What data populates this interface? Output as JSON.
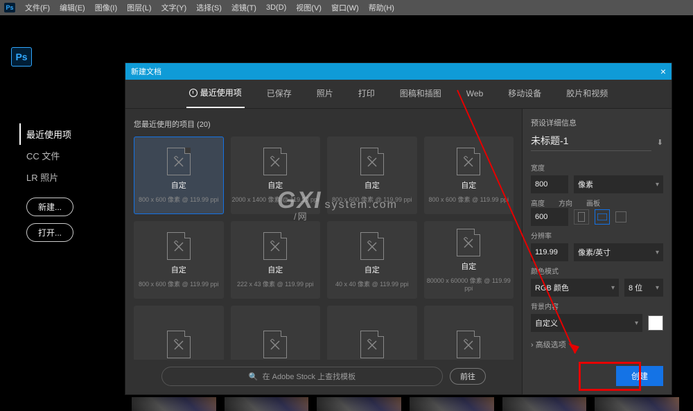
{
  "menubar": {
    "logo": "Ps",
    "items": [
      "文件(F)",
      "编辑(E)",
      "图像(I)",
      "图层(L)",
      "文字(Y)",
      "选择(S)",
      "滤镜(T)",
      "3D(D)",
      "视图(V)",
      "窗口(W)",
      "帮助(H)"
    ]
  },
  "workspace": {
    "logo": "Ps",
    "left_items": [
      "最近使用项",
      "CC 文件",
      "LR 照片"
    ],
    "active_left": 0,
    "new_btn": "新建...",
    "open_btn": "打开..."
  },
  "dialog": {
    "title": "新建文档",
    "tabs": [
      "最近使用项",
      "已保存",
      "照片",
      "打印",
      "图稿和插图",
      "Web",
      "移动设备",
      "胶片和视频"
    ],
    "active_tab": 0,
    "recent_label": "您最近使用的项目  (20)",
    "presets": [
      {
        "name": "自定",
        "dim": "800 x 600 像素 @ 119.99 ppi",
        "selected": true
      },
      {
        "name": "自定",
        "dim": "2000 x 1400 像素 @ 119.99 ppi"
      },
      {
        "name": "自定",
        "dim": "800 x 600 像素 @ 119.99 ppi"
      },
      {
        "name": "自定",
        "dim": "800 x 600 像素 @ 119.99 ppi"
      },
      {
        "name": "自定",
        "dim": "800 x 600 像素 @ 119.99 ppi"
      },
      {
        "name": "自定",
        "dim": "222 x 43 像素 @ 119.99 ppi"
      },
      {
        "name": "自定",
        "dim": "40 x 40 像素 @ 119.99 ppi"
      },
      {
        "name": "自定",
        "dim": "80000 x 60000 像素 @ 119.99 ppi"
      },
      {
        "name": "",
        "dim": ""
      },
      {
        "name": "",
        "dim": ""
      },
      {
        "name": "",
        "dim": ""
      },
      {
        "name": "",
        "dim": ""
      }
    ],
    "search_placeholder": "在 Adobe Stock 上查找模板",
    "go_btn": "前往",
    "detail": {
      "header": "预设详细信息",
      "name": "未标题-1",
      "width_label": "宽度",
      "width": "800",
      "width_unit": "像素",
      "height_label": "高度",
      "orient_label": "方向",
      "artboard_label": "画板",
      "height": "600",
      "res_label": "分辨率",
      "res": "119.99",
      "res_unit": "像素/英寸",
      "color_label": "颜色模式",
      "color_mode": "RGB 颜色",
      "bit": "8 位",
      "bg_label": "背景内容",
      "bg": "自定义",
      "adv": "高级选项",
      "create": "创建"
    }
  },
  "watermark": "GXI"
}
